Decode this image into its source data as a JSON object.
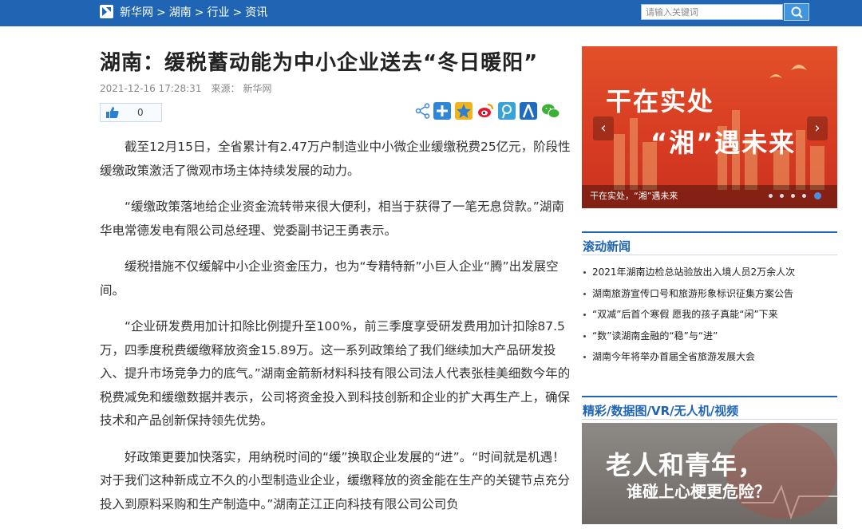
{
  "header": {
    "breadcrumb": [
      "新华网",
      "湖南",
      "行业",
      "资讯"
    ],
    "breadcrumb_sep": ">",
    "search_placeholder": "请输入关键词"
  },
  "article": {
    "title": "湖南：缓税蓄动能为中小企业送去“冬日暖阳”",
    "datetime": "2021-12-16 17:28:31",
    "source_label": "来源：",
    "source": "新华网",
    "likes": "0",
    "share_icons": [
      "share-icon",
      "plus-share-icon",
      "qzone-icon",
      "weibo-icon",
      "tencent-weibo-icon",
      "renren-icon",
      "wechat-icon"
    ],
    "paragraphs": [
      "截至12月15日，全省累计有2.47万户制造业中小微企业缓缴税费25亿元，阶段性缓缴政策激活了微观市场主体持续发展的动力。",
      "“缓缴政策落地给企业资金流转带来很大便利，相当于获得了一笔无息贷款。”湖南华电常德发电有限公司总经理、党委副书记王勇表示。",
      "缓税措施不仅缓解中小企业资金压力，也为“专精特新”小巨人企业“腾”出发展空间。",
      "“企业研发费用加计扣除比例提升至100%，前三季度享受研发费用加计扣除87.5万，四季度税费缓缴释放资金15.89万。这一系列政策给了我们继续加大产品研发投入、提升市场竞争力的底气。”湖南金箭新材料科技有限公司法人代表张桂美细数今年的税费减免和缓缴数据并表示，公司将资金投入到科技创新和企业的扩大再生产上，确保技术和产品创新保持领先优势。",
      "好政策更要加快落实，用纳税时间的“缓”换取企业发展的“进”。“时间就是机遇！对于我们这种新成立不久的小型制造业企业，缓缴释放的资金能在生产的关键节点充分投入到原料采购和生产制造中。”湖南芷江正向科技有限公司公司负"
    ]
  },
  "sidebar": {
    "banner": {
      "headline1": "干在实处",
      "headline2": "“湘”遇未来",
      "caption": "干在实处，“湘”遇未来",
      "prev": "‹",
      "next": "›",
      "slide_count": 5,
      "active_slide": 5
    },
    "rolling_news_title": "滚动新闻",
    "rolling_news": [
      "2021年湖南边检总站验放出入境人员2万余人次",
      "湖南旅游宣传口号和旅游形象标识征集方案公告",
      "“双减”后首个寒假 愿我的孩子真能“闲”下来",
      "“数”读湖南金融的“稳”与“进”",
      "湖南今年将举办首届全省旅游发展大会"
    ],
    "media_title": "精彩/数据图/VR/无人机/视频",
    "promo": {
      "line1": "老人和青年，",
      "line2": "谁碰上心梗更危险？"
    }
  },
  "colors": {
    "brand_blue": "#1f65b3",
    "banner_red": "#d73b22"
  }
}
